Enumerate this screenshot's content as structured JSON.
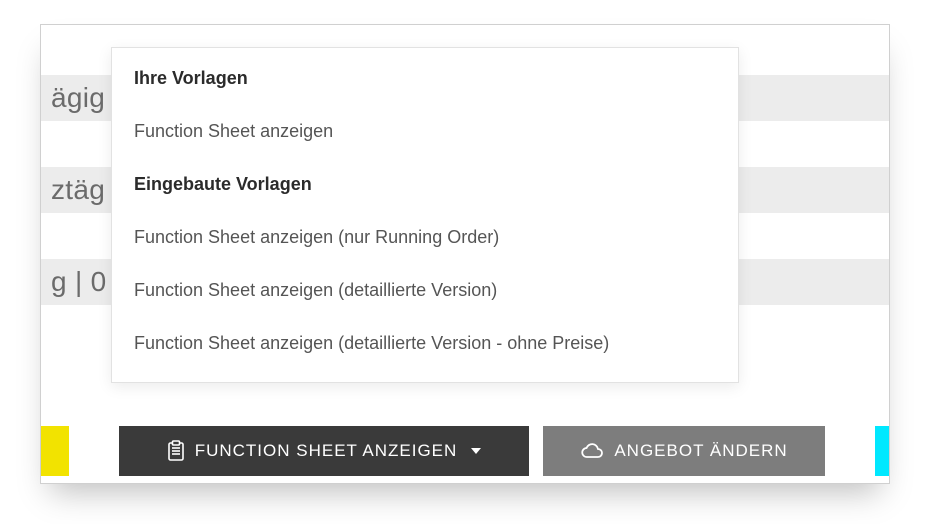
{
  "background_rows": [
    "ägig",
    "ztäg",
    "g | 0"
  ],
  "dropdown": {
    "sections": [
      {
        "header": "Ihre Vorlagen",
        "items": [
          "Function Sheet anzeigen"
        ]
      },
      {
        "header": "Eingebaute Vorlagen",
        "items": [
          "Function Sheet anzeigen (nur Running Order)",
          "Function Sheet anzeigen (detaillierte Version)",
          "Function Sheet anzeigen (detaillierte Version - ohne Preise)"
        ]
      }
    ]
  },
  "buttons": {
    "function_sheet": "FUNCTION SHEET ANZEIGEN",
    "change_offer": "ANGEBOT ÄNDERN"
  },
  "colors": {
    "dark_button": "#3a3a3a",
    "grey_button": "#7d7d7d",
    "yellow": "#f2e300",
    "cyan": "#00e8ff",
    "row_bg": "#ececec"
  }
}
